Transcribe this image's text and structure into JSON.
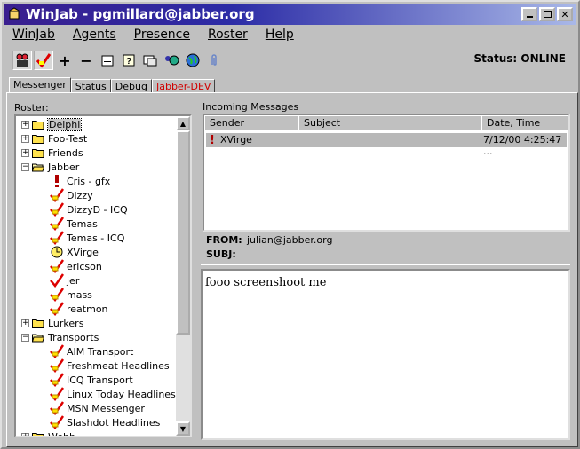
{
  "window": {
    "title": "WinJab - pgmillard@jabber.org"
  },
  "menu": [
    {
      "label": "WinJab"
    },
    {
      "label": "Agents"
    },
    {
      "label": "Presence"
    },
    {
      "label": "Roster"
    },
    {
      "label": "Help"
    }
  ],
  "status": {
    "text": "Status: ONLINE"
  },
  "tabs": [
    {
      "label": "Messenger"
    },
    {
      "label": "Status"
    },
    {
      "label": "Debug"
    },
    {
      "label": "Jabber-DEV"
    }
  ],
  "roster": {
    "label": "Roster:",
    "rows": [
      {
        "text": "Delphi",
        "type": "group",
        "expander": "+",
        "selected": true
      },
      {
        "text": "Foo-Test",
        "type": "group",
        "expander": "+"
      },
      {
        "text": "Friends",
        "type": "group",
        "expander": "+"
      },
      {
        "text": "Jabber",
        "type": "group",
        "expander": "−",
        "open": true
      },
      {
        "text": "Cris - gfx",
        "type": "contact",
        "status": "away"
      },
      {
        "text": "Dizzy",
        "type": "contact",
        "status": "offline"
      },
      {
        "text": "DizzyD - ICQ",
        "type": "contact",
        "status": "offline"
      },
      {
        "text": "Temas",
        "type": "contact",
        "status": "offline"
      },
      {
        "text": "Temas - ICQ",
        "type": "contact",
        "status": "offline"
      },
      {
        "text": "XVirge",
        "type": "contact",
        "status": "idle"
      },
      {
        "text": "ericson",
        "type": "contact",
        "status": "offline"
      },
      {
        "text": "jer",
        "type": "contact",
        "status": "online"
      },
      {
        "text": "mass",
        "type": "contact",
        "status": "offline"
      },
      {
        "text": "reatmon",
        "type": "contact",
        "status": "offline"
      },
      {
        "text": "Lurkers",
        "type": "group",
        "expander": "+"
      },
      {
        "text": "Transports",
        "type": "group",
        "expander": "−",
        "open": true
      },
      {
        "text": "AIM Transport",
        "type": "contact",
        "status": "offline"
      },
      {
        "text": "Freshmeat Headlines",
        "type": "contact",
        "status": "offline"
      },
      {
        "text": "ICQ Transport",
        "type": "contact",
        "status": "offline"
      },
      {
        "text": "Linux Today Headlines",
        "type": "contact",
        "status": "offline"
      },
      {
        "text": "MSN Messenger",
        "type": "contact",
        "status": "offline"
      },
      {
        "text": "Slashdot Headlines",
        "type": "contact",
        "status": "offline"
      },
      {
        "text": "Webb",
        "type": "group",
        "expander": "+"
      }
    ]
  },
  "incoming": {
    "label": "Incoming Messages",
    "columns": [
      "Sender",
      "Subject",
      "Date, Time"
    ],
    "rows": [
      {
        "sender": "XVirge",
        "subject": "",
        "datetime": "7/12/00 4:25:47 ..."
      }
    ]
  },
  "message": {
    "from_label": "FROM:",
    "from": "julian@jabber.org",
    "subj_label": "SUBJ:",
    "subj": "",
    "body": "fooo screenshoot me"
  },
  "colors": {
    "title_start": "#3a1f8f",
    "title_end": "#a9b8e8",
    "tab_red": "#d00000",
    "selection": "#b8b8b8"
  }
}
